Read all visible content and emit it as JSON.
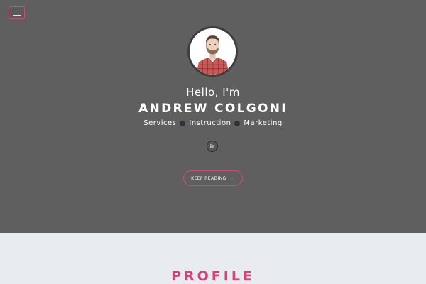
{
  "header": {
    "menu_icon": "hamburger-menu-icon"
  },
  "hero": {
    "avatar_icon": "portrait-avatar",
    "greeting": "Hello, I'm",
    "name": "ANDREW COLGONI",
    "services": [
      "Services",
      "Instruction",
      "Marketing"
    ],
    "social": {
      "linkedin_label": "in"
    },
    "keep_reading_label": "KEEP READING",
    "keep_reading_icon": "chevron-down-icon"
  },
  "profile": {
    "title": "PROFILE"
  },
  "colors": {
    "hero_bg": "#5f5f5f",
    "accent": "#d6437a",
    "section_bg": "#e8ecef",
    "dot": "#2b3440"
  }
}
